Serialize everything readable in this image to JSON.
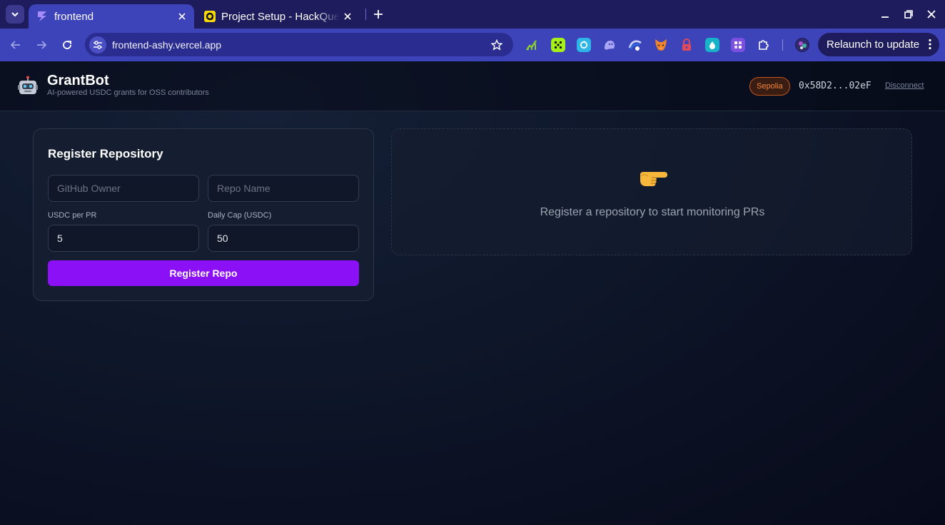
{
  "browser": {
    "tabs": [
      {
        "title": "frontend",
        "icon": "bolt-icon",
        "active": true
      },
      {
        "title": "Project Setup - HackQuest",
        "icon": "hackquest-icon",
        "active": false
      }
    ],
    "url": "frontend-ashy.vercel.app",
    "relaunch_label": "Relaunch to update",
    "extensions": [
      "chart-extension-icon",
      "dice-extension-icon",
      "refresh-extension-icon",
      "ghost-extension-icon",
      "arc-extension-icon",
      "fox-wallet-icon",
      "lock-extension-icon",
      "drop-extension-icon",
      "puzzle-box-extension-icon",
      "puzzle-icon"
    ]
  },
  "app": {
    "name": "GrantBot",
    "tagline": "AI-powered USDC grants for OSS contributors",
    "network": "Sepolia",
    "wallet_address": "0x58D2...02eF",
    "disconnect_label": "Disconnect"
  },
  "register_form": {
    "title": "Register Repository",
    "owner_placeholder": "GitHub Owner",
    "repo_placeholder": "Repo Name",
    "usdc_per_pr_label": "USDC per PR",
    "usdc_per_pr_value": "5",
    "daily_cap_label": "Daily Cap (USDC)",
    "daily_cap_value": "50",
    "submit_label": "Register Repo"
  },
  "empty_state": {
    "icon": "pointing-hand-icon",
    "message": "Register a repository to start monitoring PRs"
  },
  "colors": {
    "accent": "#8b10f5",
    "chrome_dark": "#1e1c5c",
    "chrome_toolbar": "#3d43b8",
    "badge_orange": "#f0873c"
  }
}
